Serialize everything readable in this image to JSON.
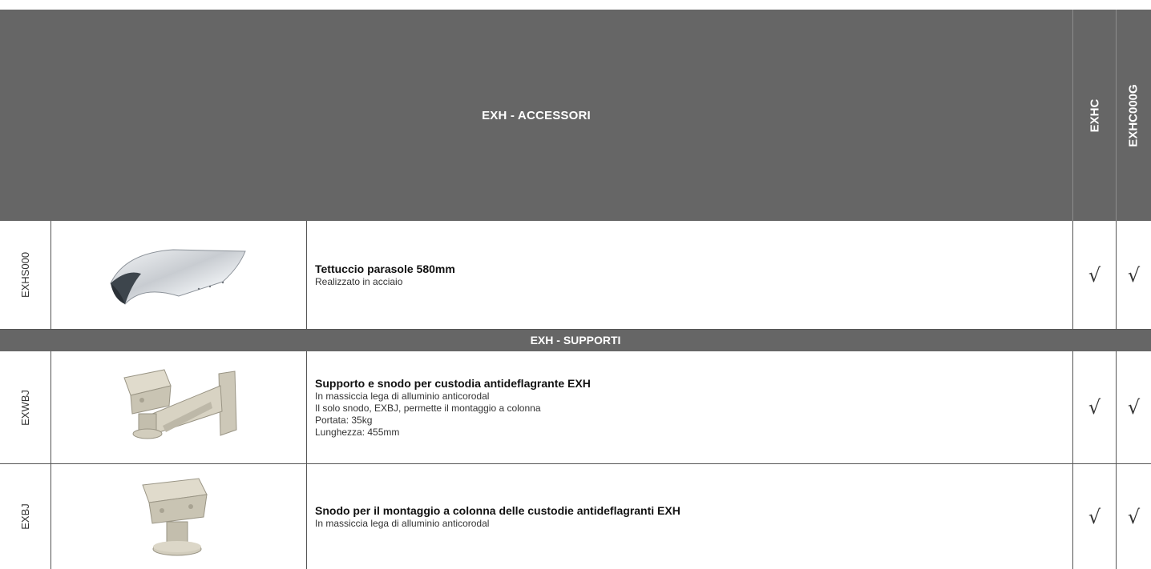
{
  "header": {
    "title": "EXH - ACCESSORI",
    "col1": "EXHC",
    "col2": "EXHC000G"
  },
  "rows": [
    {
      "code": "EXHS000",
      "image": "sunshield-image",
      "title": "Tettuccio parasole 580mm",
      "lines": [
        "Realizzato in acciaio"
      ],
      "check1": "√",
      "check2": "√"
    },
    {
      "code": "EXWBJ",
      "image": "wall-bracket-image",
      "title": "Supporto e snodo per custodia antideflagrante EXH",
      "lines": [
        "In massiccia lega di alluminio anticorodal",
        "Il solo snodo, EXBJ, permette il montaggio a colonna",
        "Portata: 35kg",
        "Lunghezza: 455mm"
      ],
      "check1": "√",
      "check2": "√"
    },
    {
      "code": "EXBJ",
      "image": "pole-joint-image",
      "title": "Snodo per il montaggio a colonna delle custodie antideflagranti EXH",
      "lines": [
        "In massiccia lega di alluminio anticorodal"
      ],
      "check1": "√",
      "check2": "√"
    }
  ],
  "section": {
    "title": "EXH - SUPPORTI"
  },
  "colors": {
    "header_bg": "#666666",
    "header_text": "#ffffff",
    "grid": "#555555"
  }
}
